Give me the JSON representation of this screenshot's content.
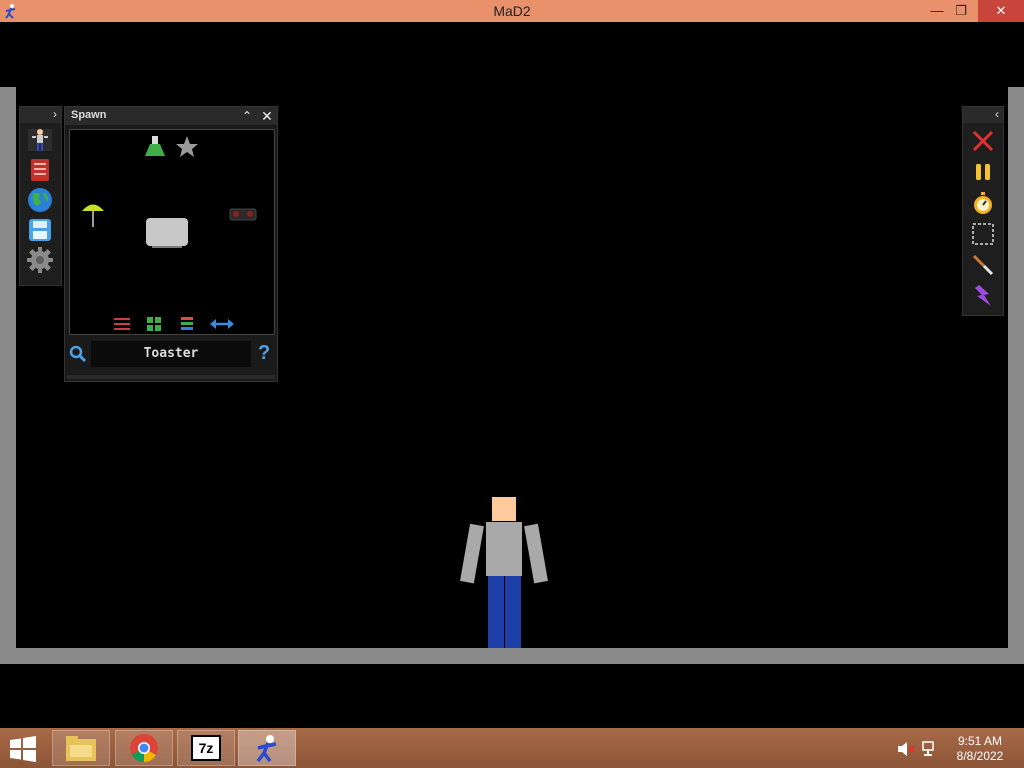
{
  "window": {
    "title": "MaD2",
    "minimize_glyph": "—",
    "maximize_glyph": "❐",
    "close_glyph": "✕"
  },
  "left_toolbar": {
    "toggle_glyph": "›",
    "items": [
      {
        "icon": "ragdoll-pose-icon"
      },
      {
        "icon": "book-icon"
      },
      {
        "icon": "globe-icon"
      },
      {
        "icon": "save-icon"
      },
      {
        "icon": "gear-icon"
      }
    ]
  },
  "spawn_panel": {
    "title": "Spawn",
    "minimize_glyph": "⌃",
    "close_glyph": "✕",
    "search_value": "Toaster",
    "help_glyph": "?"
  },
  "right_toolbar": {
    "toggle_glyph": "‹",
    "items": [
      {
        "icon": "delete-x-icon",
        "color": "#e0312f"
      },
      {
        "icon": "pause-icon",
        "color": "#f2c230"
      },
      {
        "icon": "stopwatch-icon",
        "color": "#f2b226"
      },
      {
        "icon": "selection-box-icon",
        "color": "#dddddd"
      },
      {
        "icon": "knife-icon",
        "color": "#c8c8c8"
      },
      {
        "icon": "lightning-icon",
        "color": "#9b4de0"
      }
    ]
  },
  "taskbar": {
    "apps": [
      {
        "icon": "file-explorer-icon"
      },
      {
        "icon": "chrome-icon"
      },
      {
        "icon": "7zip-icon",
        "label": "7z"
      },
      {
        "icon": "mad2-app-icon",
        "active": true
      }
    ],
    "time": "9:51 AM",
    "date": "8/8/2022"
  },
  "colors": {
    "titlebar": "#e8916a",
    "wall": "#8a8a8a",
    "ragdoll_head": "#ffcb9c",
    "ragdoll_shirt": "#a9a9a9",
    "ragdoll_pants": "#1f3fa8"
  }
}
